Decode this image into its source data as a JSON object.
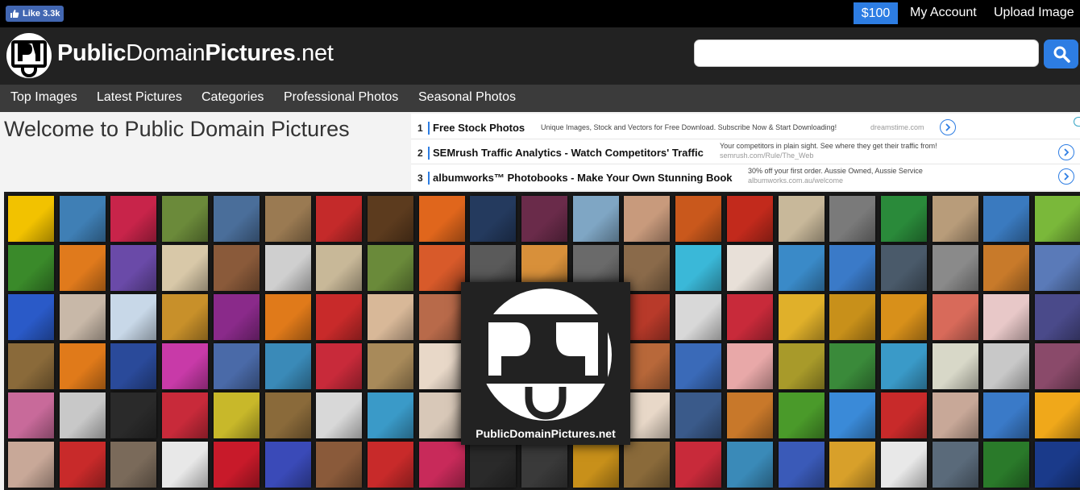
{
  "topbar": {
    "fb_like_label": "Like 3.3k",
    "price_label": "$100",
    "my_account": "My Account",
    "upload_image": "Upload Image"
  },
  "header": {
    "logo_bold_1": "Public",
    "logo_regular_1": "Domain",
    "logo_bold_2": "Pictures",
    "logo_regular_2": ".net",
    "search_value": "",
    "search_icon": "search-icon"
  },
  "nav": {
    "items": [
      "Top Images",
      "Latest Pictures",
      "Categories",
      "Professional Photos",
      "Seasonal Photos"
    ]
  },
  "welcome": "Welcome to Public Domain Pictures",
  "ads": [
    {
      "num": "1",
      "title": "Free Stock Photos",
      "desc": "Unique Images, Stock and Vectors for Free Download. Subscribe Now & Start Downloading!",
      "url": "dreamstime.com"
    },
    {
      "num": "2",
      "title": "SEMrush Traffic Analytics - Watch Competitors' Traffic",
      "desc": "Your competitors in plain sight. See where they get their traffic from!",
      "url": "semrush.com/Rule/The_Web"
    },
    {
      "num": "3",
      "title": "albumworks™ Photobooks - Make Your Own Stunning Book",
      "desc": "30% off your first order. Aussie Owned, Aussie Service",
      "url": "albumworks.com.au/welcome"
    }
  ],
  "mosaic": {
    "logo_caption": "PublicDomainPictures.net",
    "colors": [
      [
        "#f2c200",
        "#3f7fb5",
        "#c8244a",
        "#6b8a3a",
        "#4a6e9a",
        "#9a7a52",
        "#c42a2a",
        "#5c3b1e",
        "#e0661c",
        "#243a5e",
        "#6a2b4a",
        "#7fa6c4",
        "#c89a7c",
        "#c9581c",
        "#c22a1c",
        "#c8b89a",
        "#7a7a7a",
        "#2a8a3a",
        "#b89c7a",
        "#3a7abf",
        "#7ab83a"
      ],
      [
        "#3a8a2a",
        "#e07a1c",
        "#6a4aa8",
        "#d8c8a8",
        "#8a5a3a",
        "#cfcfcf",
        "#c8b898",
        "#6a8a3a",
        "#d85a2a",
        "#5a5a5a",
        "#d8903a",
        "#6a6a6a",
        "#8a6a4a",
        "#3ab8d8",
        "#e8e0d8",
        "#3a8ac8",
        "#3a7ac8",
        "#4a5a6a",
        "#8a8a8a",
        "#c87a2a",
        "#5a7ab8"
      ],
      [
        "#2a5ac8",
        "#c8b8a8",
        "#c8d8e8",
        "#c8902a",
        "#8a2a8a",
        "#e07a1a",
        "#c82a2a",
        "#d8b898",
        "#b86a4a",
        "#3a3a3a",
        "#3a3a3a",
        "#3a3a3a",
        "#b83a2a",
        "#d8d8d8",
        "#c82a3a",
        "#e0b02a",
        "#c8901a",
        "#d8901a",
        "#d86a5a",
        "#e8c8c8",
        "#4a4a8a"
      ],
      [
        "#8a6a3a",
        "#e07a1a",
        "#2a4a9a",
        "#c83aa8",
        "#4a6aa8",
        "#3a8ab8",
        "#c82a3a",
        "#a88a5a",
        "#e8d8c8",
        "#3a3a3a",
        "#3a3a3a",
        "#3a3a3a",
        "#b8683a",
        "#3a6ab8",
        "#e8a8a8",
        "#a89a2a",
        "#3a8a3a",
        "#3a9ac8",
        "#d8d8c8",
        "#c8c8c8",
        "#8a4a6a"
      ],
      [
        "#c86a9a",
        "#c8c8c8",
        "#2a2a2a",
        "#c82a3a",
        "#c8b82a",
        "#8a6a3a",
        "#d8d8d8",
        "#3a9ac8",
        "#d8c8b8",
        "#3a3a3a",
        "#3a3a3a",
        "#3a3a3a",
        "#e8d8c8",
        "#3a5a8a",
        "#c8782a",
        "#4a9a2a",
        "#3a8ad8",
        "#c82a2a",
        "#c8a898",
        "#3a7ac8",
        "#f0a81a"
      ],
      [
        "#c8a898",
        "#c82a2a",
        "#7a6a5a",
        "#e8e8e8",
        "#c81a2a",
        "#3a4ab8",
        "#8a5a3a",
        "#c82a2a",
        "#c82a5a",
        "#2a2a2a",
        "#3a3a3a",
        "#c8901a",
        "#8a6a3a",
        "#c82a3a",
        "#3a8ab8",
        "#3a5ab8",
        "#d8a02a",
        "#e8e8e8",
        "#5a6a7a",
        "#2a7a2a",
        "#1a3a8a"
      ]
    ]
  }
}
